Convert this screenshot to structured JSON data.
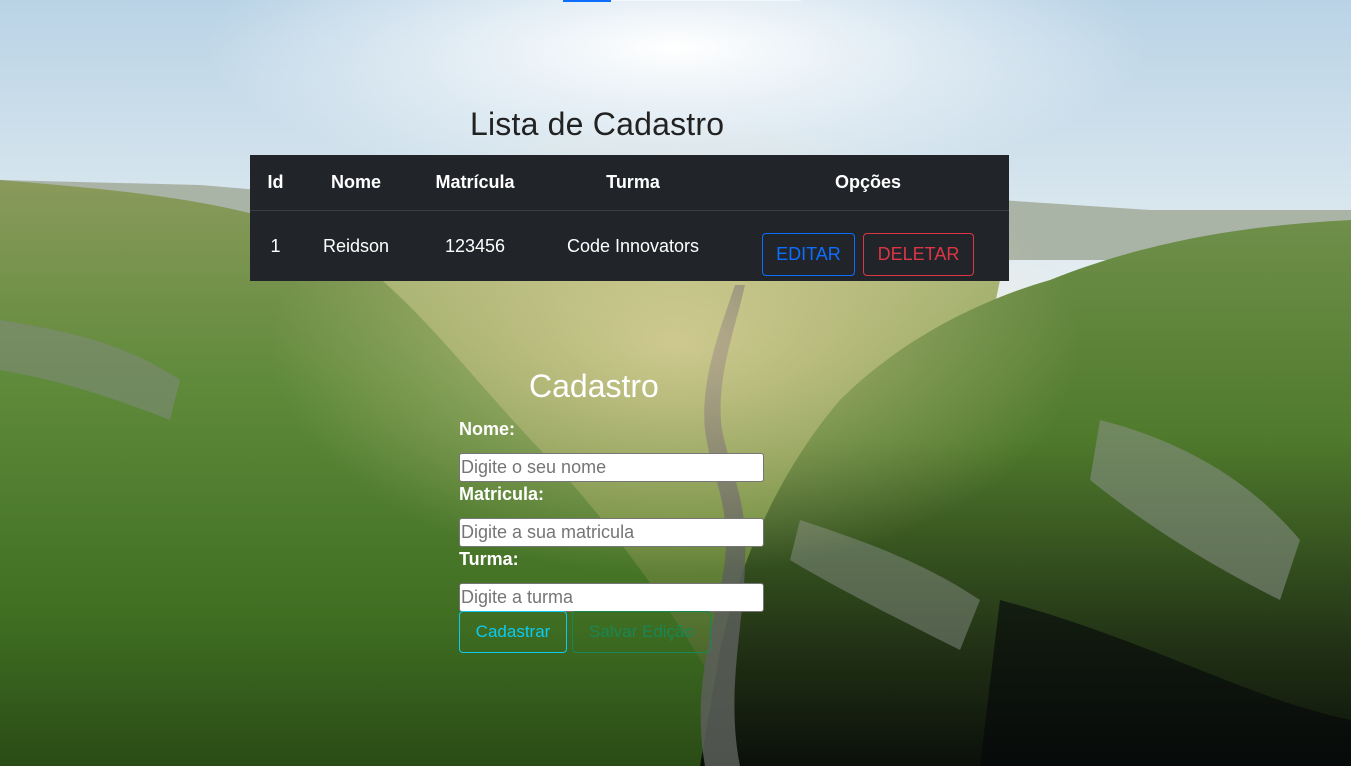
{
  "list": {
    "title": "Lista de Cadastro",
    "columns": [
      "Id",
      "Nome",
      "Matrícula",
      "Turma",
      "Opções"
    ],
    "rows": [
      {
        "id": "1",
        "nome": "Reidson",
        "matricula": "123456",
        "turma": "Code Innovators"
      }
    ],
    "edit_label": "EDITAR",
    "delete_label": "DELETAR"
  },
  "form": {
    "title": "Cadastro",
    "nome_label": "Nome:",
    "nome_placeholder": "Digite o seu nome",
    "matricula_label": "Matricula:",
    "matricula_placeholder": "Digite a sua matricula",
    "turma_label": "Turma:",
    "turma_placeholder": "Digite a turma",
    "submit_label": "Cadastrar",
    "save_label": "Salvar Edição"
  },
  "colors": {
    "table_bg": "#212529",
    "edit": "#0d6efd",
    "delete": "#dc3545",
    "submit": "#0dcaf0",
    "save": "#198754"
  }
}
